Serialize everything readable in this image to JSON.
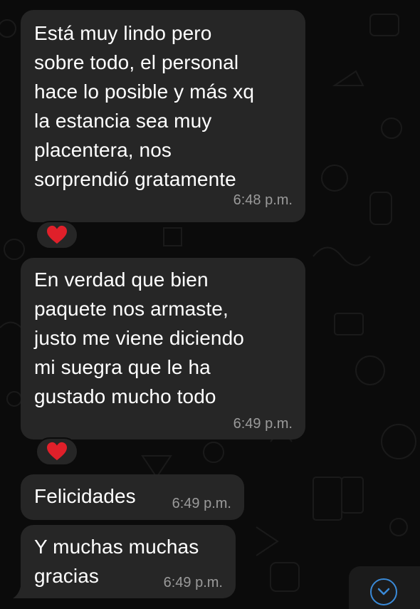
{
  "messages": [
    {
      "text": "Está muy lindo pero\nsobre todo, el personal\nhace lo posible y más xq\nla estancia sea muy\nplacentera, nos\nsorprendió gratamente",
      "time": "6:48 p.m.",
      "reaction": "heart"
    },
    {
      "text": "En verdad que bien\npaquete nos armaste,\njusto me viene diciendo\nmi suegra que le ha\ngustado mucho todo",
      "time": "6:49 p.m.",
      "reaction": "heart"
    },
    {
      "text": "Felicidades",
      "time": "6:49 p.m."
    },
    {
      "text": "Y muchas muchas\ngracias",
      "time": "6:49 p.m."
    }
  ],
  "colors": {
    "bubble": "#262626",
    "background": "#0b0b0b",
    "time_text": "#9a9a9a",
    "heart": "#e0202a",
    "scroll_accent": "#3a8ad8"
  },
  "icons": {
    "reaction": "heart-icon",
    "scroll": "chevron-down-icon"
  }
}
